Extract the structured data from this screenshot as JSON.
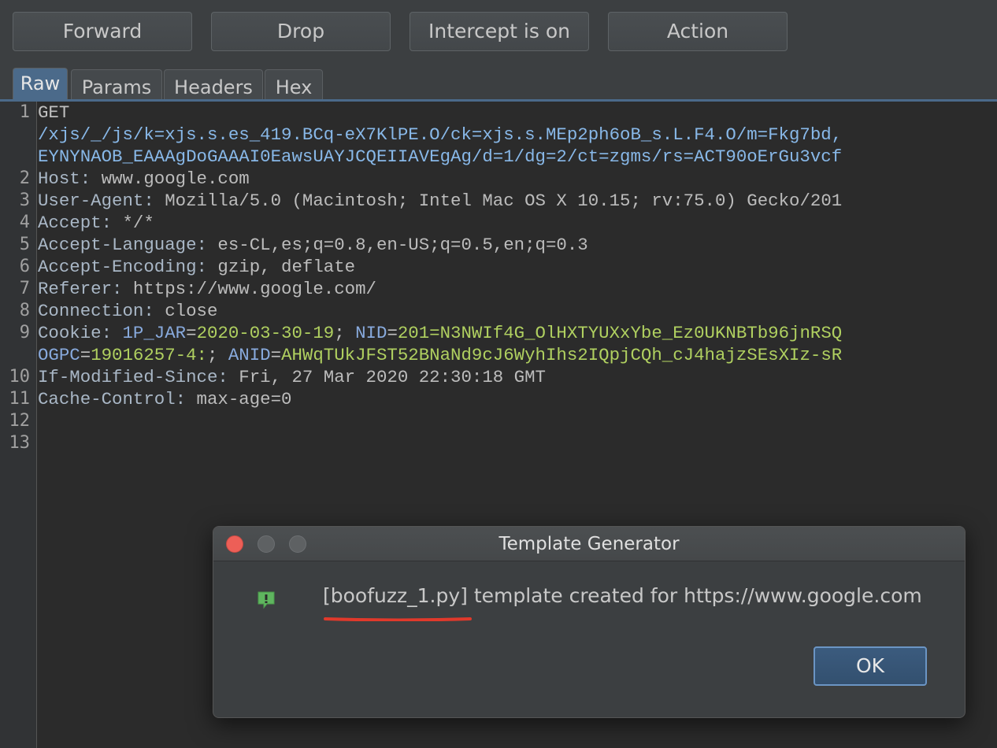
{
  "toolbar": {
    "forward": "Forward",
    "drop": "Drop",
    "intercept": "Intercept is on",
    "action": "Action"
  },
  "tabs": [
    "Raw",
    "Params",
    "Headers",
    "Hex"
  ],
  "editor": {
    "line_numbers": [
      "1",
      "2",
      "3",
      "4",
      "5",
      "6",
      "7",
      "8",
      "9",
      "10",
      "11",
      "12",
      "13"
    ],
    "line1_method": "GET",
    "line1_cont1": "/xjs/_/js/k=xjs.s.es_419.BCq-eX7KlPE.O/ck=xjs.s.MEp2ph6oB_s.L.F4.O/m=Fkg7bd,",
    "line1_cont2": "EYNYNAOB_EAAAgDoGAAAI0EawsUAYJCQEIIAVEgAg/d=1/dg=2/ct=zgms/rs=ACT90oErGu3vcf",
    "host_key": "Host:",
    "host_val": " www.google.com",
    "ua_key": "User-Agent:",
    "ua_val": " Mozilla/5.0 (Macintosh; Intel Mac OS X 10.15; rv:75.0) Gecko/201",
    "accept_key": "Accept:",
    "accept_val": " */*",
    "lang_key": "Accept-Language:",
    "lang_val": " es-CL,es;q=0.8,en-US;q=0.5,en;q=0.3",
    "enc_key": "Accept-Encoding:",
    "enc_val": " gzip, deflate",
    "ref_key": "Referer:",
    "ref_val": " https://www.google.com/",
    "conn_key": "Connection:",
    "conn_val": " close",
    "cookie_key": "Cookie:",
    "c1_name": "1P_JAR",
    "c1_val": "2020-03-30-19",
    "c2_name": "NID",
    "c2_val": "201=N3NWIf4G_OlHXTYUXxYbe_Ez0UKNBTb96jnRSQ",
    "c3_name": "OGPC",
    "c3_val": "19016257-4:",
    "c4_name": "ANID",
    "c4_val": "AHWqTUkJFST52BNaNd9cJ6WyhIhs2IQpjCQh_cJ4hajzSEsXIz-sR",
    "ims_key": "If-Modified-Since:",
    "ims_val": " Fri, 27 Mar 2020 22:30:18 GMT",
    "cc_key": "Cache-Control:",
    "cc_val": " max-age=0"
  },
  "dialog": {
    "title": "Template Generator",
    "message": "[boofuzz_1.py] template created for https://www.google.com",
    "ok": "OK"
  },
  "colors": {
    "accent": "#4b6a8a",
    "cookie_value": "#b0d060",
    "underline": "#e0392b"
  },
  "icons": [
    "close-light",
    "minimize-light",
    "zoom-light",
    "alert-icon"
  ]
}
